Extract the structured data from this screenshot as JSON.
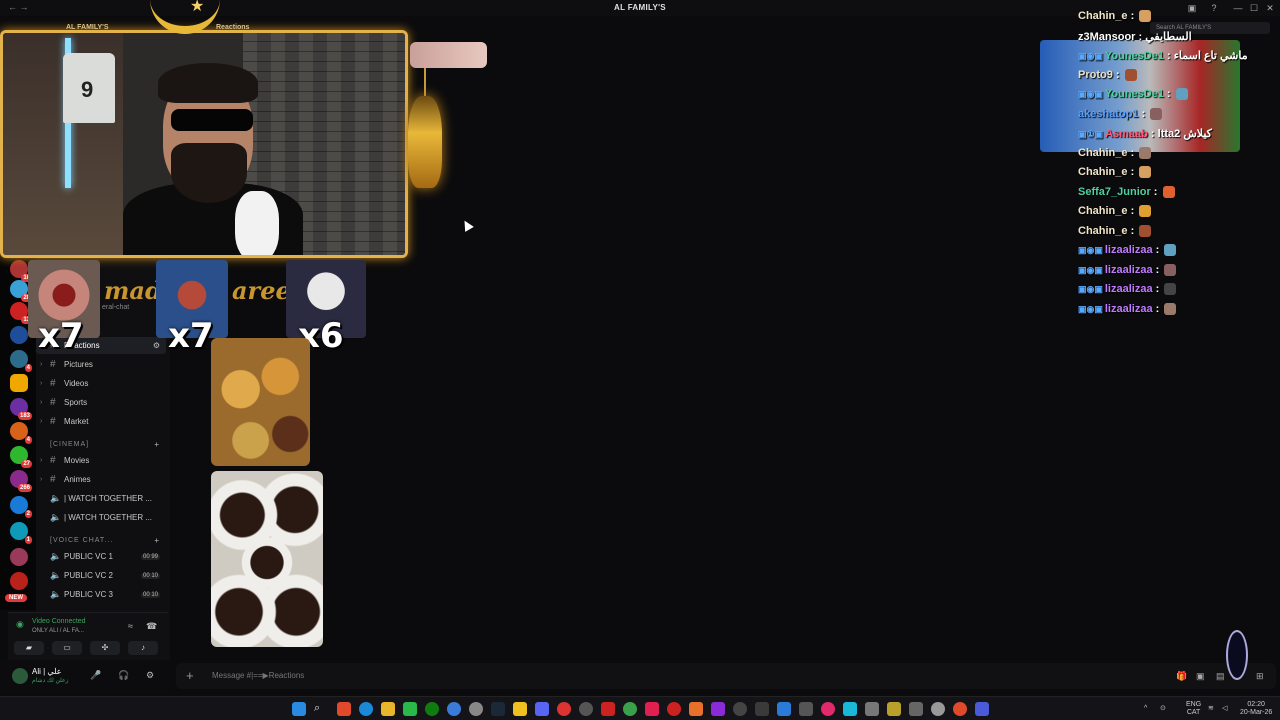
{
  "window": {
    "title": "AL FAMILY'S",
    "search_placeholder": "Search AL FAMILY'S"
  },
  "overlay": {
    "server_label": "AL FAMILY'S",
    "reactions_label": "Reactions",
    "reactions": [
      "x7",
      "x7",
      "x6"
    ],
    "gold_text_1": "mad",
    "gold_text_2": "aree",
    "general_chat": "eral-chat",
    "jersey_number": "9"
  },
  "channels": [
    {
      "label": "Reactions",
      "type": "text",
      "active": true
    },
    {
      "label": "Pictures",
      "type": "text"
    },
    {
      "label": "Videos",
      "type": "text"
    },
    {
      "label": "Sports",
      "type": "text"
    },
    {
      "label": "Market",
      "type": "text"
    },
    {
      "label": "[CINEMA]",
      "type": "category"
    },
    {
      "label": "Movies",
      "type": "text"
    },
    {
      "label": "Animes",
      "type": "text"
    },
    {
      "label": "| WATCH TOGETHER ...",
      "type": "voice"
    },
    {
      "label": "| WATCH TOGETHER ...",
      "type": "voice"
    },
    {
      "label": "[VOICE CHAT...",
      "type": "category"
    },
    {
      "label": "PUBLIC VC 1",
      "type": "voice",
      "count": "00 99"
    },
    {
      "label": "PUBLIC VC 2",
      "type": "voice",
      "count": "00 10"
    },
    {
      "label": "PUBLIC VC 3",
      "type": "voice",
      "count": "00 10"
    }
  ],
  "server_badges": [
    "16",
    "28",
    "13",
    "4",
    "183",
    "4",
    "27",
    "266",
    "2",
    "1"
  ],
  "new_badge": "NEW",
  "voice": {
    "status": "Video Connected",
    "channel": "ONLY ALI / AL FA..."
  },
  "user": {
    "name": "Ali | علي",
    "status": "زعلن لك دشام"
  },
  "composer": {
    "placeholder": "Message #|==▶Reactions"
  },
  "stream_chat": [
    {
      "user": "Chahin_e",
      "color": "#f0e5c8",
      "badges": ""
    },
    {
      "user": "z3Mansoor",
      "color": "#ffffff",
      "badges": "",
      "msg": "السطايفي"
    },
    {
      "user": "YounesDe1",
      "color": "#4fd0a0",
      "badges": "▣◉▣",
      "msg": "ماشي تاع اسماء"
    },
    {
      "user": "Proto9",
      "color": "#e8e0c8",
      "badges": ""
    },
    {
      "user": "YounesDe1",
      "color": "#4fd0a0",
      "badges": "▣◉▣"
    },
    {
      "user": "akeshatop1",
      "color": "#58a0ff",
      "badges": ""
    },
    {
      "user": "Asmaab",
      "color": "#ff5a78",
      "badges": "▣①▣",
      "msg": "ltta2 كيلاش"
    },
    {
      "user": "Chahin_e",
      "color": "#f0e5c8",
      "badges": ""
    },
    {
      "user": "Chahin_e",
      "color": "#f0e5c8",
      "badges": ""
    },
    {
      "user": "Seffa7_Junior",
      "color": "#4fd0a0",
      "badges": ""
    },
    {
      "user": "Chahin_e",
      "color": "#f0e5c8",
      "badges": ""
    },
    {
      "user": "Chahin_e",
      "color": "#f0e5c8",
      "badges": ""
    },
    {
      "user": "lizaalizaa",
      "color": "#c07aff",
      "badges": "▣◉▣"
    },
    {
      "user": "lizaalizaa",
      "color": "#c07aff",
      "badges": "▣◉▣"
    },
    {
      "user": "lizaalizaa",
      "color": "#c07aff",
      "badges": "▣◉▣"
    },
    {
      "user": "lizaalizaa",
      "color": "#c07aff",
      "badges": "▣◉▣"
    }
  ],
  "tray": {
    "lang": "ENG",
    "region": "CAT",
    "time": "02:20",
    "date": "20-Mar-26"
  }
}
